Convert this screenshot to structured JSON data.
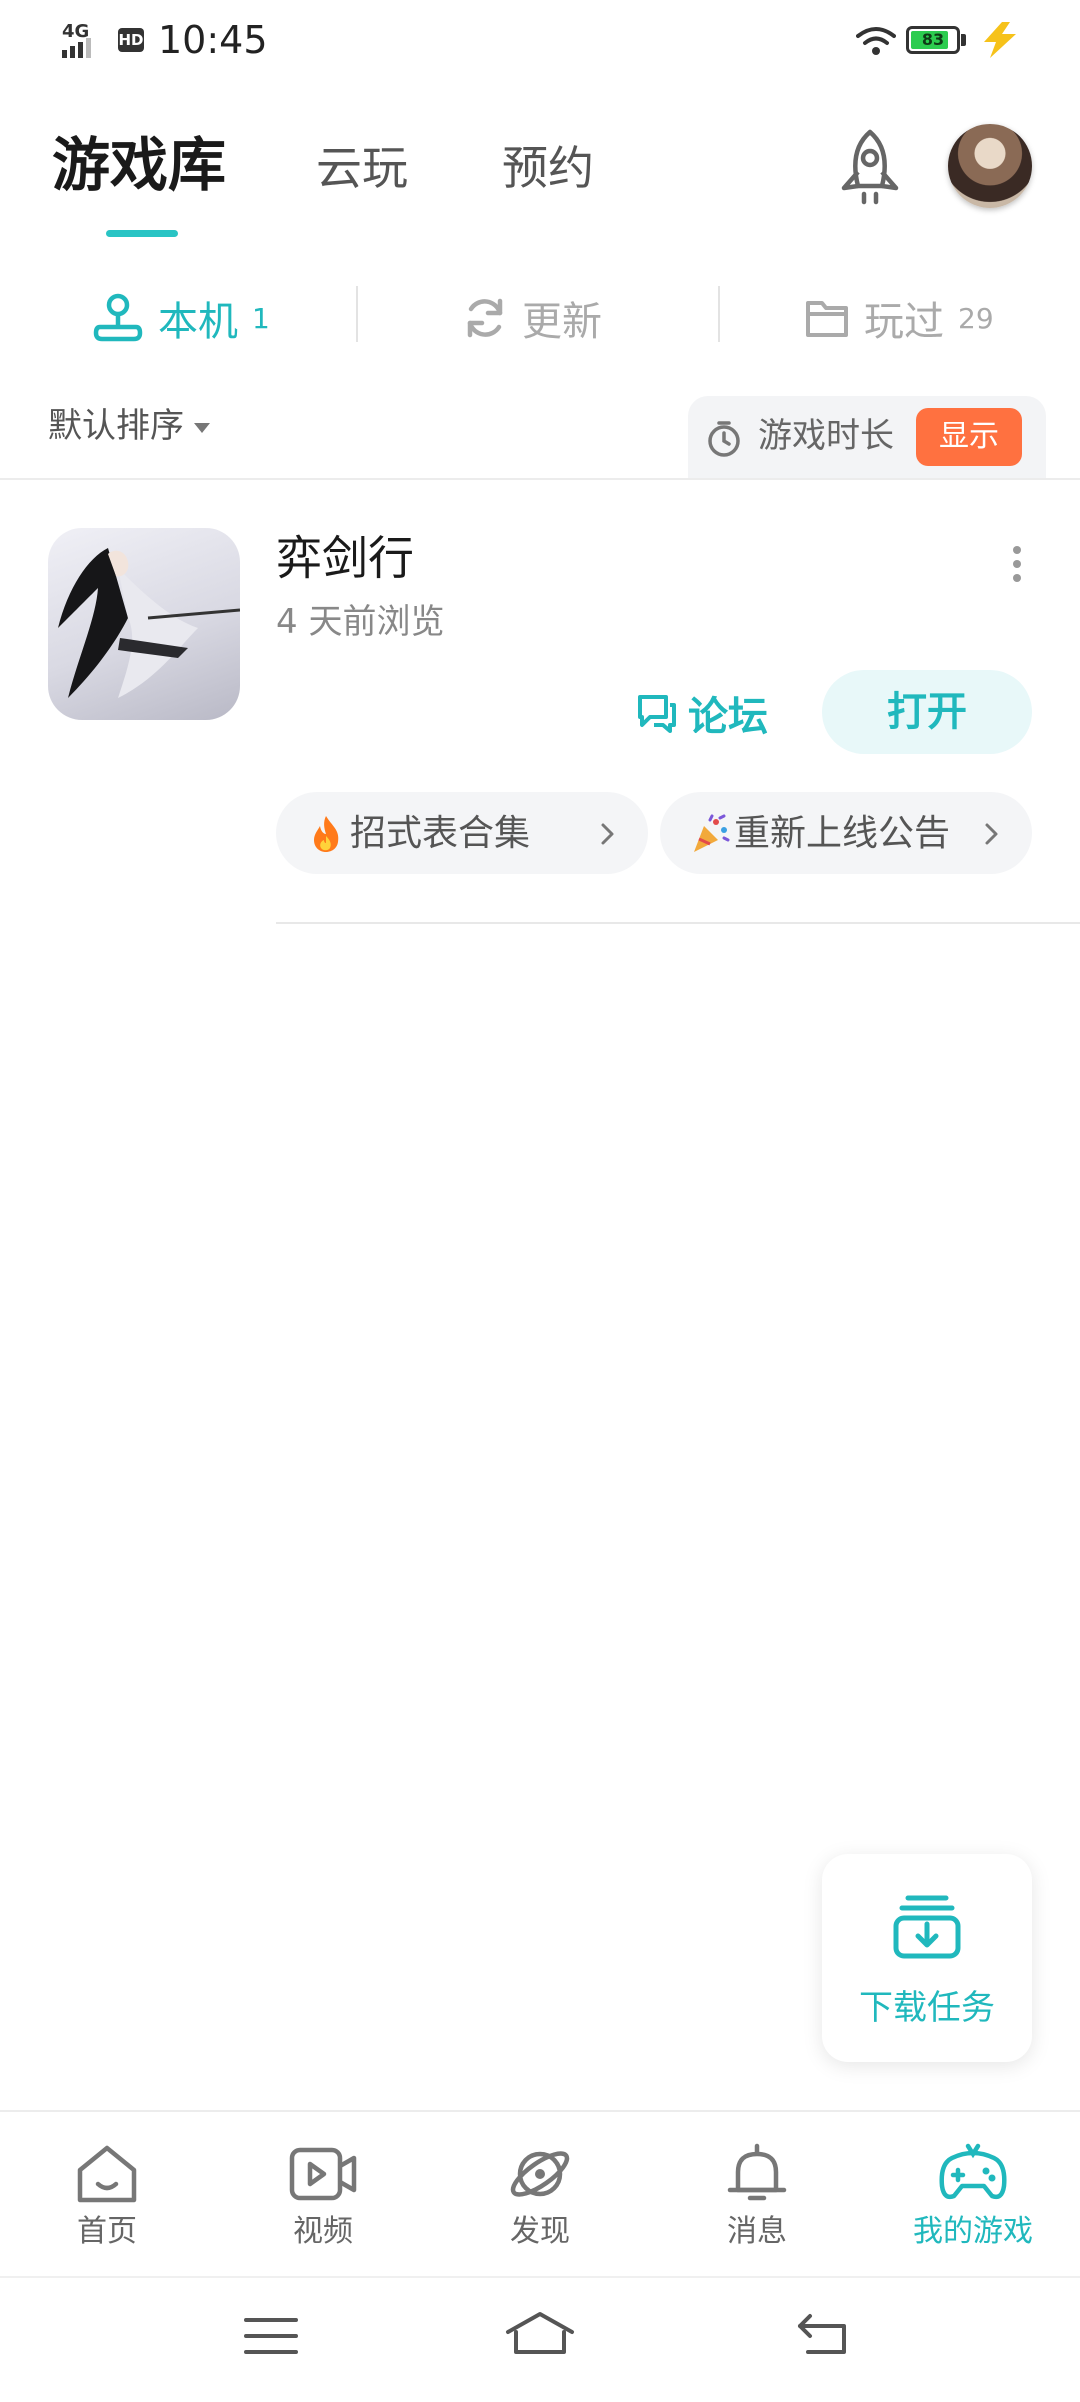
{
  "status_bar": {
    "network": "4G",
    "hd": "HD",
    "time": "10:45",
    "battery": "83",
    "battery_level": 0.83
  },
  "top_tabs": {
    "items": [
      {
        "label": "游戏库",
        "active": true
      },
      {
        "label": "云玩",
        "active": false
      },
      {
        "label": "预约",
        "active": false
      }
    ]
  },
  "sub_tabs": {
    "local": {
      "label": "本机",
      "count": "1"
    },
    "update": {
      "label": "更新"
    },
    "played": {
      "label": "玩过",
      "count": "29"
    }
  },
  "sort": {
    "label": "默认排序"
  },
  "duration": {
    "label": "游戏时长",
    "toggle": "显示"
  },
  "game": {
    "title": "弈剑行",
    "subtitle": "4 天前浏览",
    "forum_label": "论坛",
    "open_label": "打开",
    "chips": [
      {
        "emoji": "fire-icon",
        "text": "招式表合集"
      },
      {
        "emoji": "party-popper-icon",
        "text": "重新上线公告"
      }
    ]
  },
  "download": {
    "label": "下载任务"
  },
  "bottom_nav": {
    "items": [
      {
        "label": "首页",
        "icon": "home-icon",
        "active": false
      },
      {
        "label": "视频",
        "icon": "video-icon",
        "active": false
      },
      {
        "label": "发现",
        "icon": "planet-icon",
        "active": false
      },
      {
        "label": "消息",
        "icon": "bell-icon",
        "active": false
      },
      {
        "label": "我的游戏",
        "icon": "gamepad-icon",
        "active": true
      }
    ]
  },
  "colors": {
    "accent": "#20b8bd",
    "orange": "#ff7140",
    "battery_green": "#2ccc4f"
  }
}
